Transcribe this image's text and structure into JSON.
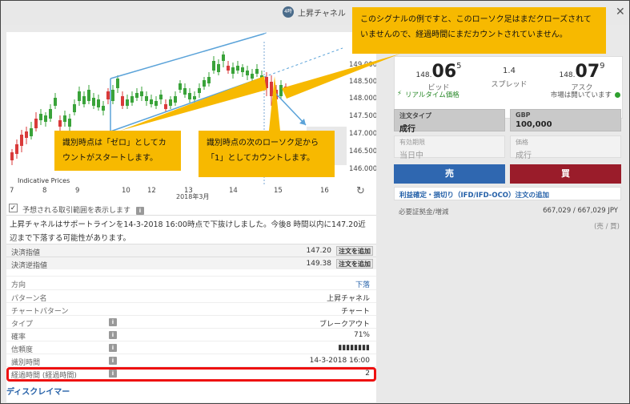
{
  "window": {
    "badge": "4時",
    "title": "上昇チャネル",
    "close_icon": "close-icon"
  },
  "chart": {
    "watermark": "Indicative Prices",
    "month_label": "2018年3月",
    "x_ticks": [
      "7",
      "8",
      "9",
      "10",
      "12",
      "13",
      "14",
      "15",
      "16"
    ],
    "y_ticks": [
      "149.000",
      "148.500",
      "148.000",
      "147.500",
      "147.000",
      "146.500",
      "146.000"
    ],
    "up_color": "#3aa33a",
    "down_color": "#d93a3a",
    "channel_color": "#5ba3d9",
    "refresh_icon": "refresh-icon"
  },
  "show_range": {
    "label": "予想される取引範囲を表示します",
    "checked": true
  },
  "description": "上昇チャネルはサポートラインを14-3-2018 16:00時点で下抜けしました。今後8 時間以内に147.20近辺まで下落する可能性があります。",
  "orders": [
    {
      "label": "決済指値",
      "value": "147.20",
      "button": "注文を追加"
    },
    {
      "label": "決済逆指値",
      "value": "149.38",
      "button": "注文を追加"
    }
  ],
  "details": {
    "direction_label": "方向",
    "direction_value": "下落",
    "rows": [
      {
        "label": "パターン名",
        "value": "上昇チャネル",
        "info": false
      },
      {
        "label": "チャートパターン",
        "value": "チャート",
        "info": false
      },
      {
        "label": "タイプ",
        "value": "ブレークアウト",
        "info": true
      },
      {
        "label": "確率",
        "value": "71%",
        "info": true
      },
      {
        "label": "信頼度",
        "value": "▮▮▮▮▮▮▮▮",
        "info": true
      },
      {
        "label": "識別時間",
        "value": "14-3-2018 16:00",
        "info": true
      },
      {
        "label": "経過時間 (経過時間)",
        "value": "2",
        "info": true
      }
    ],
    "disclaimer": "ディスクレイマー"
  },
  "quote": {
    "bid_prefix": "148.",
    "bid_big": "06",
    "bid_sup": "5",
    "bid_label": "ビッド",
    "spread_value": "1.4",
    "spread_label": "スプレッド",
    "ask_prefix": "148.",
    "ask_big": "07",
    "ask_sup": "9",
    "ask_label": "アスク",
    "realtime": "リアルタイム価格",
    "market_status": "市場は開いています"
  },
  "order_form": {
    "order_type_label": "注文タイプ",
    "order_type_value": "成行",
    "currency_label": "GBP",
    "amount_value": "100,000",
    "expiry_label": "有効期限",
    "expiry_value": "当日中",
    "price_label": "価格",
    "price_value": "成行",
    "sell_label": "売",
    "buy_label": "買",
    "ifd_link": "利益確定・損切り（IFD/IFD-OCO）注文の追加",
    "margin_label": "必要証拠金/増減",
    "margin_value": "667,029 / 667,029  JPY",
    "margin_sub": "(売 / 買)"
  },
  "callouts": {
    "top": "このシグナルの例ですと、このローソク足はまだクローズされていませんので、経過時間にまだカウントされていません。",
    "left": "識別時点は「ゼロ」としてカウントがスタートします。",
    "middle": "識別時点の次のローソク足から「1」としてカウントします。"
  },
  "colors": {
    "callout": "#f7b900",
    "sell": "#2f67b0",
    "buy": "#9a1c2a",
    "highlight": "#e11111"
  }
}
